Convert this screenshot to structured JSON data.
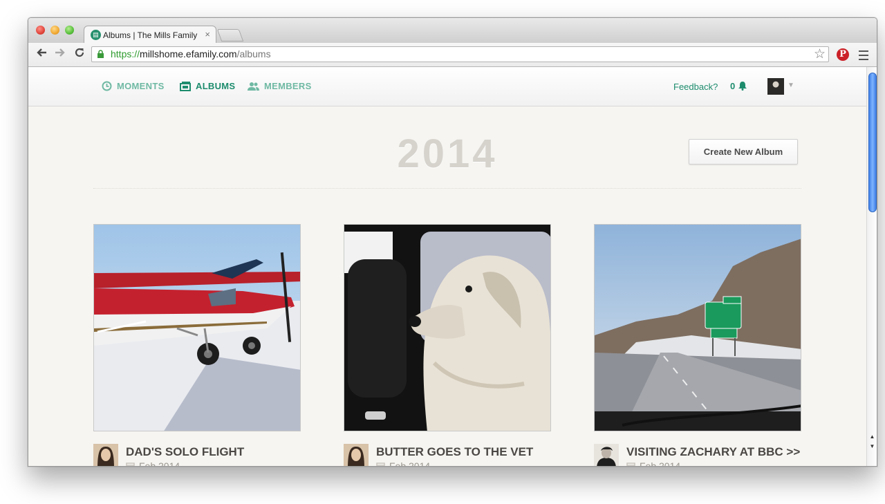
{
  "browser": {
    "tab_title": "Albums | The Mills Family",
    "tab_close": "×",
    "url": {
      "scheme": "https",
      "separator": "://",
      "host": "millshome.efamily.com",
      "path": "/albums"
    }
  },
  "nav": {
    "moments": "MOMENTS",
    "albums": "ALBUMS",
    "members": "MEMBERS",
    "feedback": "Feedback?",
    "notification_count": "0"
  },
  "main": {
    "year": "2014",
    "create_button": "Create New Album",
    "albums": [
      {
        "title": "DAD'S SOLO FLIGHT",
        "date": "Feb 2014"
      },
      {
        "title": "BUTTER GOES TO THE VET",
        "date": "Feb 2014"
      },
      {
        "title": "VISITING ZACHARY AT BBC >>",
        "date": "Feb 2014"
      }
    ]
  },
  "colors": {
    "brand_green": "#1d8c6d",
    "brand_green_light": "#6fb9a3",
    "pinterest_red": "#cb2027"
  },
  "icons": [
    "back-arrow-icon",
    "forward-arrow-icon",
    "reload-icon",
    "lock-icon",
    "star-icon",
    "pinterest-icon",
    "menu-icon",
    "clock-icon",
    "albums-icon",
    "members-icon",
    "bell-icon",
    "calendar-icon"
  ]
}
